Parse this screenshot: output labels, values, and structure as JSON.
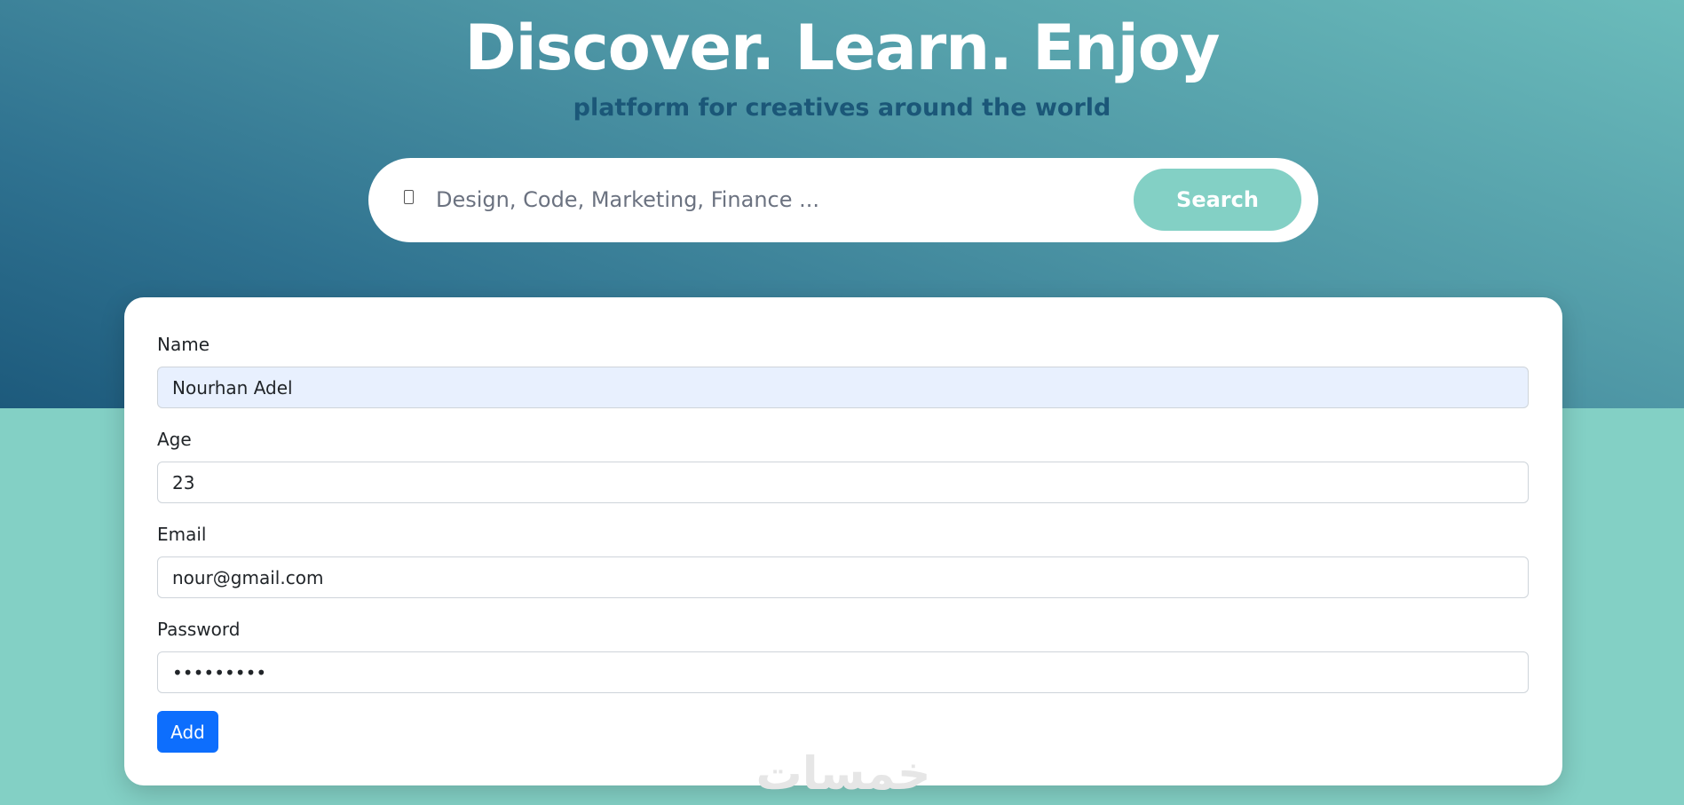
{
  "hero": {
    "title": "Discover. Learn. Enjoy",
    "subtitle": "platform for creatives around the world"
  },
  "search": {
    "icon": "search-icon",
    "placeholder": "Design, Code, Marketing, Finance ...",
    "value": "",
    "button_label": "Search"
  },
  "form": {
    "name_label": "Name",
    "name_value": "Nourhan Adel",
    "age_label": "Age",
    "age_value": "23",
    "email_label": "Email",
    "email_value": "nour@gmail.com",
    "password_label": "Password",
    "password_value": "nour12345",
    "add_label": "Add"
  },
  "watermark": "خمسات",
  "colors": {
    "accent": "#83d0c5",
    "primary_button": "#0d6efd",
    "subtitle": "#1b5778",
    "autofill": "#e8f0fe"
  }
}
